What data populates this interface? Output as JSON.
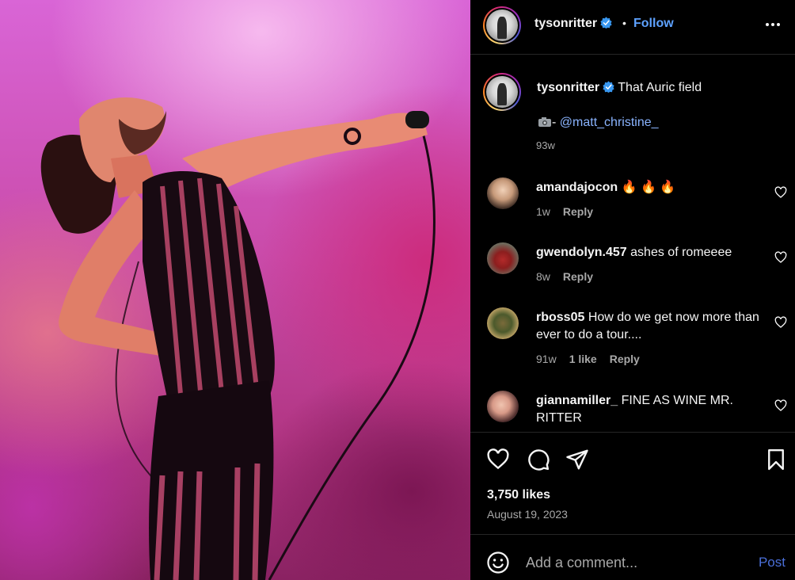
{
  "header": {
    "username": "tysonritter",
    "separator": "•",
    "follow_label": "Follow"
  },
  "caption": {
    "username": "tysonritter",
    "text": "That Auric field",
    "credit_prefix": "- ",
    "credit_mention": "@matt_christine_",
    "time": "93w"
  },
  "comments": [
    {
      "username": "amandajocon",
      "text": "🔥 🔥 🔥",
      "time": "1w",
      "likes": "",
      "reply_label": "Reply"
    },
    {
      "username": "gwendolyn.457",
      "text": "ashes of romeeee",
      "time": "8w",
      "likes": "",
      "reply_label": "Reply"
    },
    {
      "username": "rboss05",
      "text": "How do we get now more than ever to do a tour....",
      "time": "91w",
      "likes": "1 like",
      "reply_label": "Reply"
    },
    {
      "username": "giannamiller_",
      "text": "FINE AS WINE MR. RITTER",
      "time": "",
      "likes": "",
      "reply_label": ""
    }
  ],
  "post": {
    "likes": "3,750 likes",
    "date": "August 19, 2023"
  },
  "comment_box": {
    "placeholder": "Add a comment...",
    "post_label": "Post"
  },
  "colors": {
    "accent_link": "#5ea2ff",
    "mention": "#8ab4ff",
    "post_button": "#4a6fd8",
    "muted_text": "#a8a8a8",
    "background": "#000000"
  },
  "icons": [
    "verified-badge-icon",
    "more-options-icon",
    "camera-icon",
    "heart-icon",
    "comment-icon",
    "share-icon",
    "bookmark-icon",
    "emoji-icon"
  ]
}
